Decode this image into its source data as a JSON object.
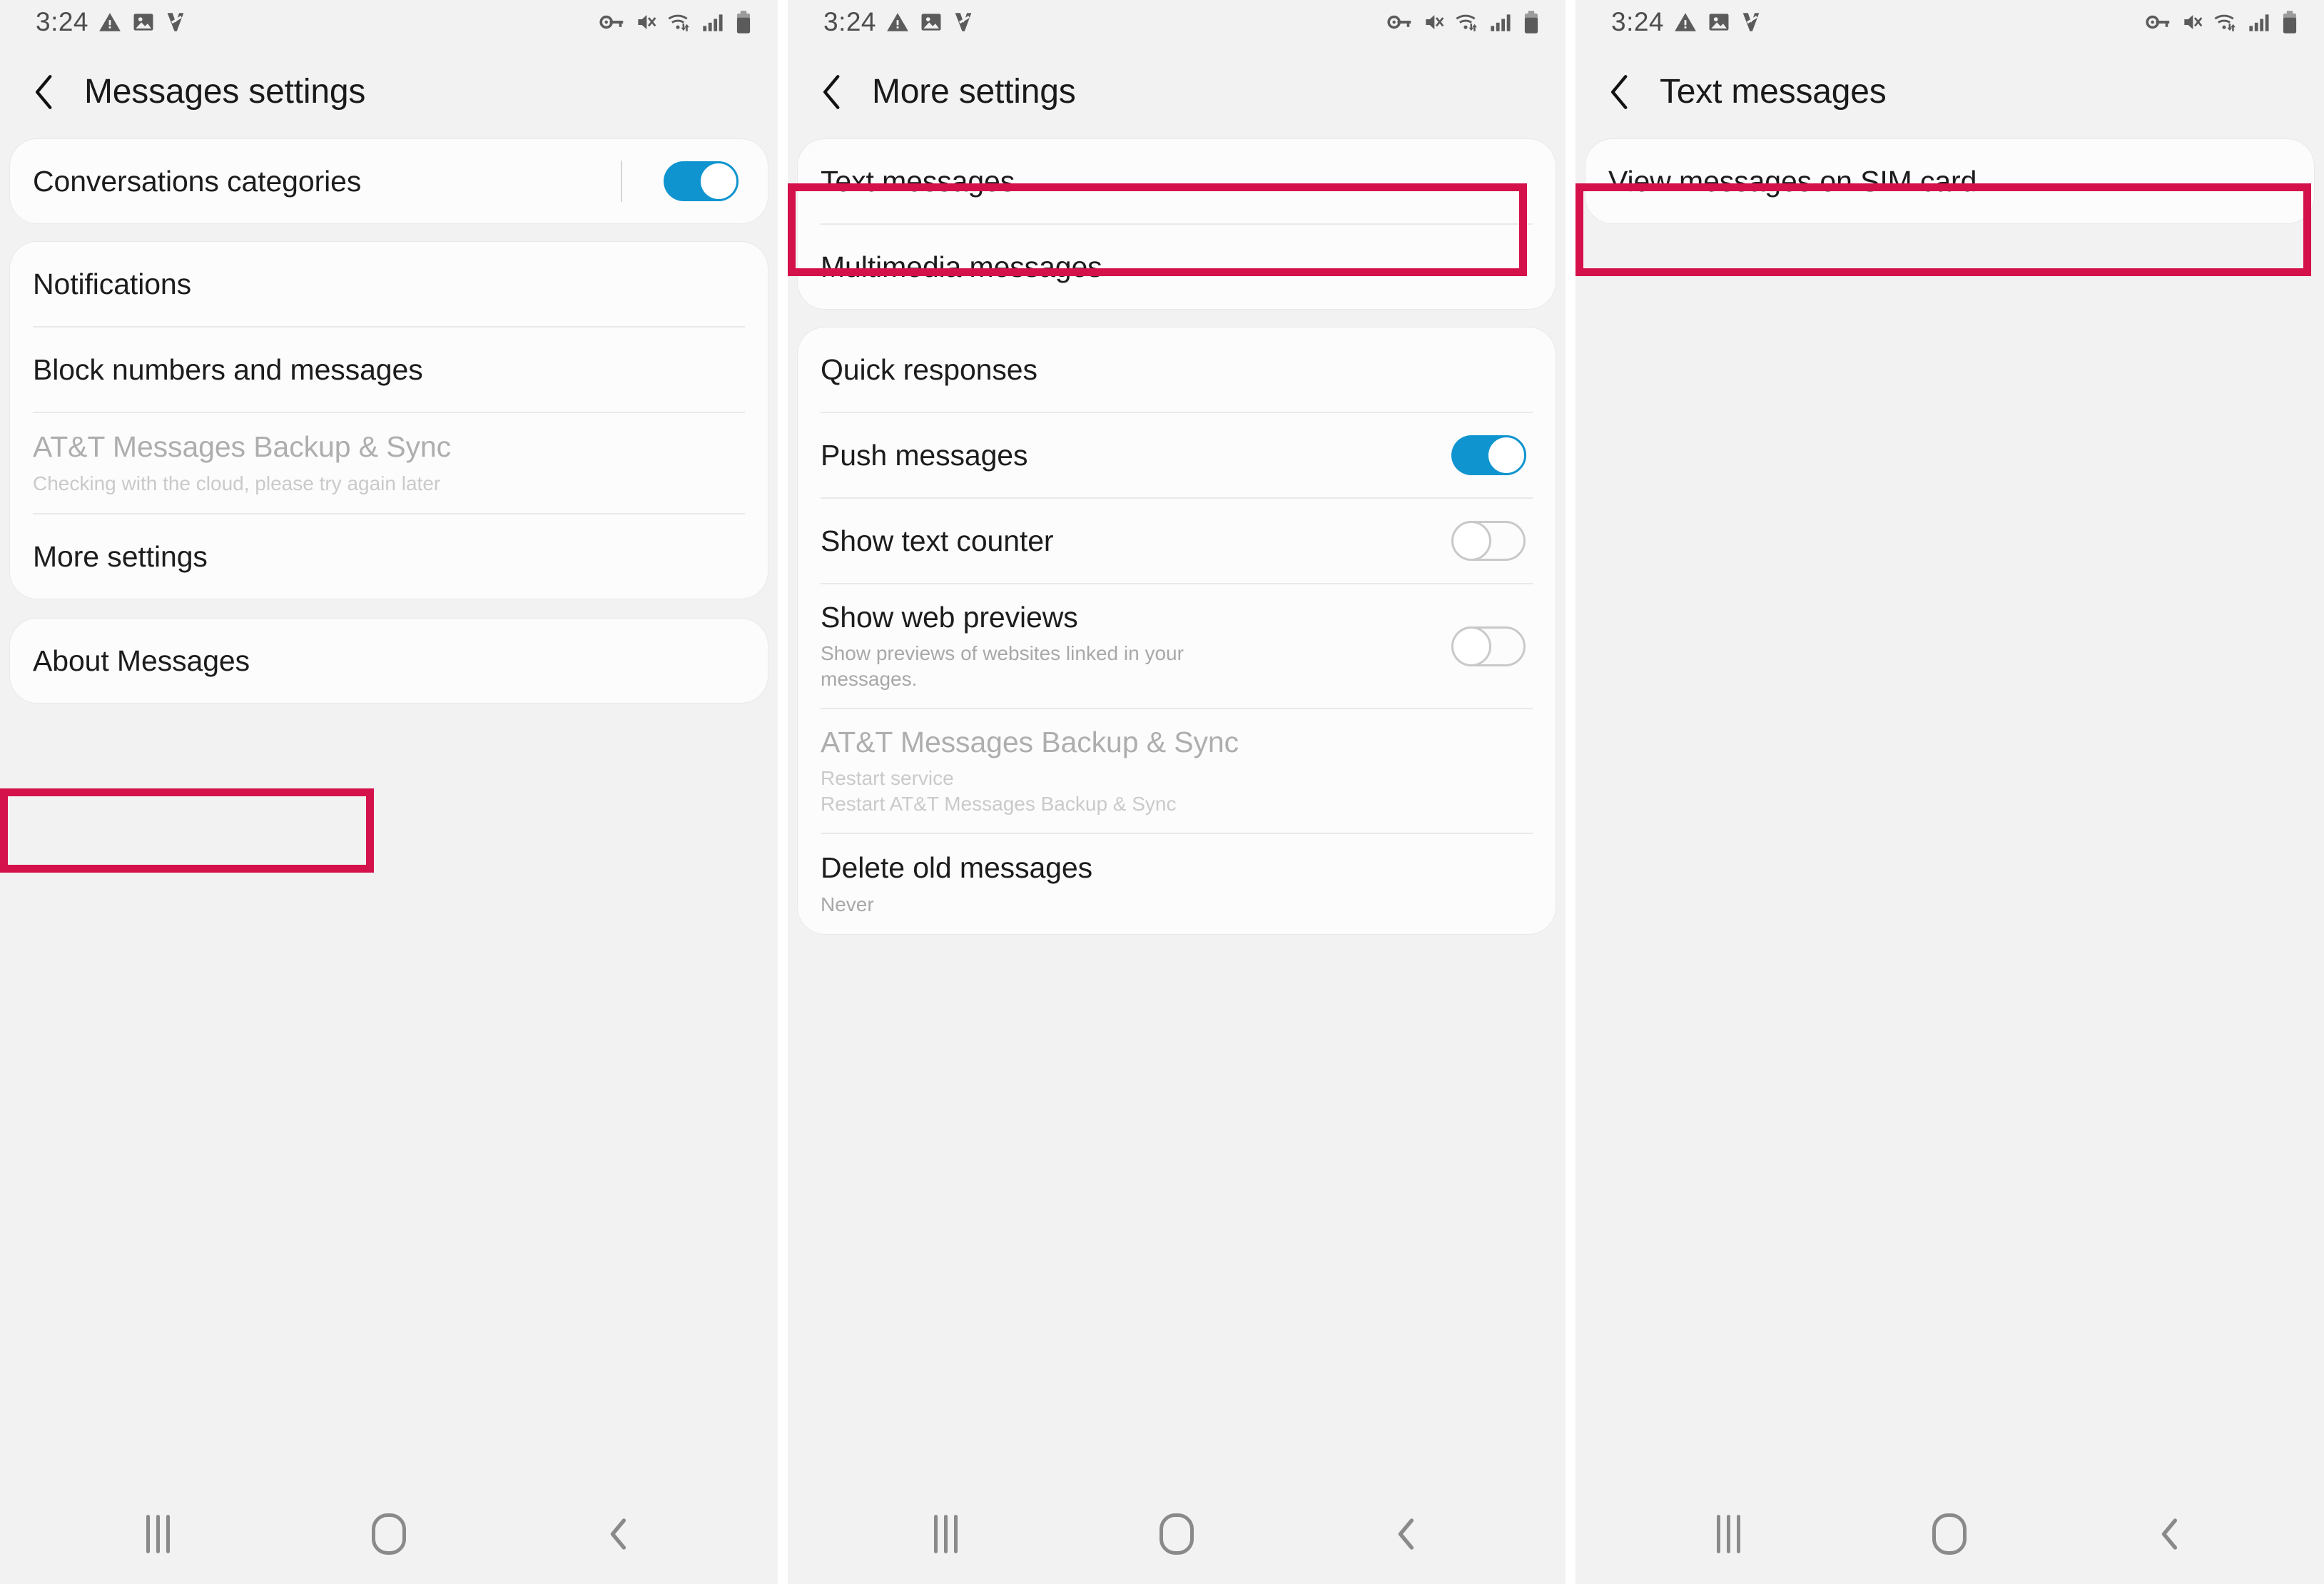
{
  "statusbar": {
    "time": "3:24",
    "left_icons": [
      "warning-triangle-icon",
      "image-icon",
      "vpn-icon"
    ],
    "right_icons": [
      "key-icon",
      "mute-icon",
      "wifi-icon",
      "signal-bars-icon",
      "battery-icon"
    ]
  },
  "highlight_color": "#d4114a",
  "accent_color": "#0f94cf",
  "panels": [
    {
      "id": "messages-settings",
      "title": "Messages settings",
      "back_icon": "chevron-left-icon",
      "cards": [
        {
          "rows": [
            {
              "title": "Conversations categories",
              "control": "toggle",
              "toggle_state": "on",
              "has_separator": true
            }
          ]
        },
        {
          "rows": [
            {
              "title": "Notifications"
            },
            {
              "title": "Block numbers and messages"
            },
            {
              "title": "AT&T Messages Backup & Sync",
              "subtitle": "Checking with the cloud, please try again later",
              "disabled": true
            },
            {
              "title": "More settings",
              "highlighted": true
            }
          ]
        },
        {
          "rows": [
            {
              "title": "About Messages"
            }
          ]
        }
      ]
    },
    {
      "id": "more-settings",
      "title": "More settings",
      "back_icon": "chevron-left-icon",
      "cards": [
        {
          "rows": [
            {
              "title": "Text messages",
              "highlighted": true
            },
            {
              "title": "Multimedia messages"
            }
          ]
        },
        {
          "rows": [
            {
              "title": "Quick responses"
            },
            {
              "title": "Push messages",
              "control": "toggle",
              "toggle_state": "on"
            },
            {
              "title": "Show text counter",
              "control": "toggle",
              "toggle_state": "off"
            },
            {
              "title": "Show web previews",
              "subtitle": "Show previews of websites linked in your messages.",
              "control": "toggle",
              "toggle_state": "off"
            },
            {
              "title": "AT&T Messages Backup & Sync",
              "subtitle": "Restart service\nRestart AT&T Messages Backup & Sync",
              "disabled": true
            },
            {
              "title": "Delete old messages",
              "subtitle": "Never"
            }
          ]
        }
      ]
    },
    {
      "id": "text-messages",
      "title": "Text messages",
      "back_icon": "chevron-left-icon",
      "cards": [
        {
          "rows": [
            {
              "title": "View messages on SIM card",
              "highlighted": true
            }
          ]
        }
      ]
    }
  ],
  "navbar": {
    "buttons": [
      {
        "name": "recents-button",
        "icon": "recents-icon"
      },
      {
        "name": "home-button",
        "icon": "home-icon"
      },
      {
        "name": "back-button",
        "icon": "chevron-left-icon"
      }
    ]
  }
}
